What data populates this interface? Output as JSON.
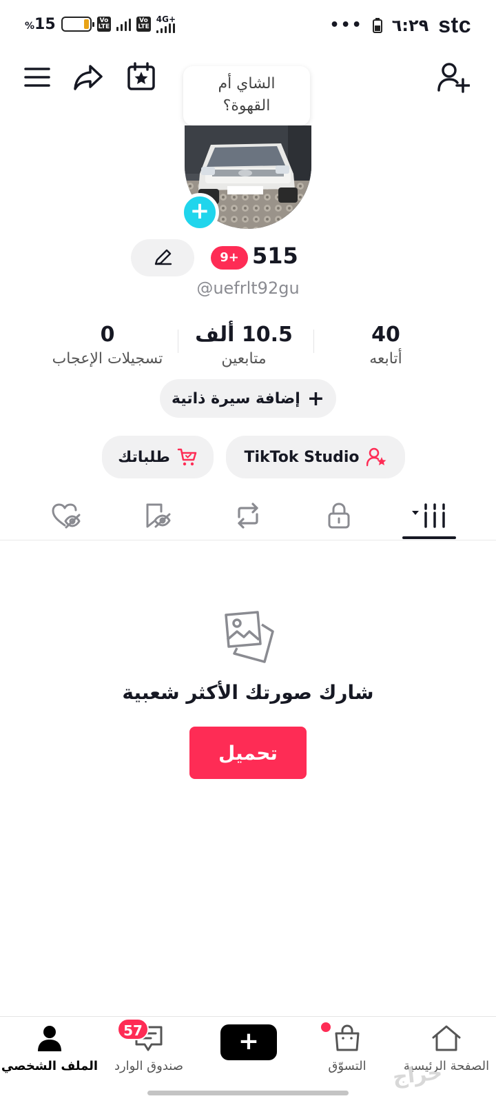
{
  "status_bar": {
    "battery_percent": "15",
    "battery_symbol": "%",
    "volte1": "Vo\nLTE",
    "volte2": "Vo\nLTE",
    "network": "4G+",
    "dots": "•••",
    "time": "٦:٢٩",
    "carrier": "stc"
  },
  "profile": {
    "note": "الشاي أم\nالقهوة؟",
    "level_badge": "9+",
    "score": "515",
    "handle": "@uefrlt92gu"
  },
  "stats": [
    {
      "value": "40",
      "label": "أتابعه"
    },
    {
      "value": "10.5 ألف",
      "label": "متابعين"
    },
    {
      "value": "0",
      "label": "تسجيلات الإعجاب"
    }
  ],
  "buttons": {
    "add_bio": "إضافة سيرة ذاتية",
    "studio": "TikTok Studio",
    "orders": "طلباتك"
  },
  "empty_state": {
    "title": "شارك صورتك الأكثر شعبية",
    "upload": "تحميل"
  },
  "nav": {
    "home": "الصفحة الرئيسية",
    "shop": "التسوّق",
    "inbox": "صندوق الوارد",
    "inbox_count": "57",
    "profile": "الملف الشخصي"
  },
  "watermark": "حراج",
  "colors": {
    "accent": "#fe2c55",
    "cyan": "#20d5ec",
    "text": "#161823"
  }
}
